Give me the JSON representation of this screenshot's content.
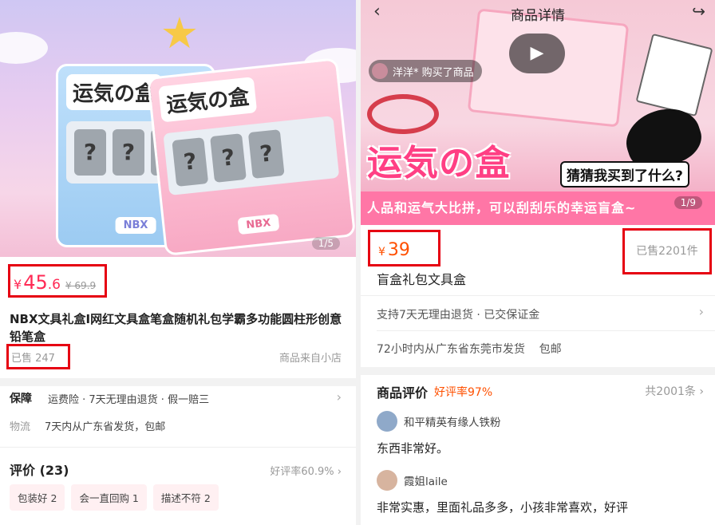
{
  "left": {
    "counter": "1/5",
    "machine1": {
      "title": "运気の盒",
      "slot": "?",
      "brand": "NBX"
    },
    "machine2": {
      "title": "运気の盒",
      "slot": "?",
      "brand": "NBX"
    },
    "price": {
      "currency": "¥",
      "integer": "45",
      "decimal": ".6",
      "original": "¥ 69.9"
    },
    "title": "NBX文具礼盒I网红文具盒笔盒随机礼包学霸多功能圆柱形创意铅笔盒",
    "sold": "已售 247",
    "shop_source": "商品来自小店",
    "guarantee": {
      "label": "保障",
      "value": "运费险 · 7天无理由退货 · 假一赔三"
    },
    "logistics": {
      "label": "物流",
      "value": "7天内从广东省发货，包邮"
    },
    "reviews": {
      "heading": "评价 (23)",
      "rate": "好评率60.9%",
      "tags": [
        "包装好 2",
        "会一直回购 1",
        "描述不符 2"
      ]
    }
  },
  "right": {
    "nav_title": "商品详情",
    "counter": "1/9",
    "buyer_notice": "洋洋* 购买了商品",
    "hero_title": "运気の盒",
    "hero_caption": "猜猜我买到了什么?",
    "hero_banner": "人品和运气大比拼，可以刮刮乐的幸运盲盒~",
    "price": {
      "currency": "¥",
      "integer": "39"
    },
    "sold": "已售2201件",
    "title": "盲盒礼包文具盒",
    "service": "支持7天无理由退货 · 已交保证金",
    "shipping": "72小时内从广东省东莞市发货    包邮",
    "reviews": {
      "heading": "商品评价",
      "rate": "好评率97%",
      "total": "共2001条",
      "items": [
        {
          "user": "和平精英有缘人铁粉",
          "comment": "东西非常好。"
        },
        {
          "user": "霞姐laile",
          "comment": "非常实惠，里面礼品多多，小孩非常喜欢，好评"
        }
      ]
    }
  },
  "colors": {
    "price_left": "#ff2a55",
    "price_right": "#ff5000",
    "highlight_box": "#e60012"
  }
}
